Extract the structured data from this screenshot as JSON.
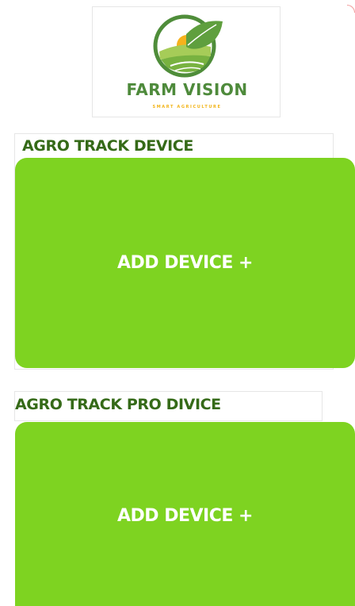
{
  "brand": {
    "name": "FARM VISION",
    "tagline": "SMART AGRICULTURE",
    "logo_icon": "leaf-sunrise-field-icon",
    "colors": {
      "name": "#4e8a3b",
      "tagline": "#f2b418",
      "sun": "#f6b21c",
      "leaf": "#5f9f3e"
    }
  },
  "sections": [
    {
      "title": "AGRO TRACK DEVICE",
      "add_button_label": "ADD DEVICE +"
    },
    {
      "title": "AGRO TRACK PRO DIVICE",
      "add_button_label": "ADD DEVICE +"
    }
  ],
  "theme": {
    "card_color": "#7ed321",
    "title_color": "#356a18",
    "button_text_color": "#ffffff"
  }
}
